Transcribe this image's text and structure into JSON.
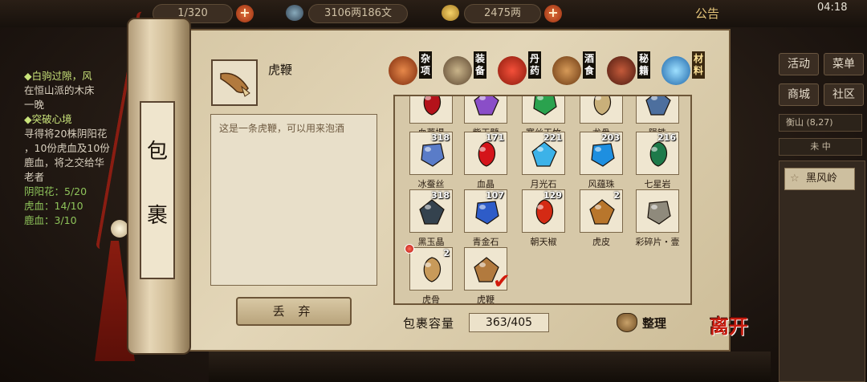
{
  "topbar": {
    "stamina": "1/320",
    "money_text": "3106两186文",
    "gold_text": "2475两",
    "notice_label": "公告",
    "clock": "04:18"
  },
  "quest": {
    "line1": "◆白驹过隙，风",
    "line2": "在恒山派的木床",
    "line3": "一晚",
    "line4": "◆突破心境",
    "line5": "寻得将20株阴阳花",
    "line6": "，10份虎血及10份",
    "line7": "鹿血，将之交给华",
    "line8": "老者",
    "req1": "阴阳花：5/20",
    "req2": "虎血：14/10",
    "req3": "鹿血：3/10"
  },
  "right_panel": {
    "btn_activity": "活动",
    "btn_menu": "菜单",
    "btn_shop": "商城",
    "btn_community": "社区",
    "location": "衡山",
    "coords": "(8,27)",
    "time_slot": "未 中",
    "place": "黑风岭"
  },
  "scroll": {
    "title_char1": "包",
    "title_char2": "裹"
  },
  "selected": {
    "name": "虎鞭",
    "description": "这是一条虎鞭，可以用来泡酒",
    "discard_label": "丢 弃"
  },
  "tabs": [
    {
      "label": "杂项",
      "icon": "misc-jar-icon",
      "color": "#b64e1c"
    },
    {
      "label": "装备",
      "icon": "equipment-icon",
      "color": "#7b6a52"
    },
    {
      "label": "丹药",
      "icon": "pill-icon",
      "color": "#c43a1c"
    },
    {
      "label": "酒食",
      "icon": "wine-food-icon",
      "color": "#9c5a28"
    },
    {
      "label": "秘籍",
      "icon": "manual-book-icon",
      "color": "#7a3a2a"
    },
    {
      "label": "材料",
      "icon": "material-crystal-icon",
      "color": "#3c8fd0"
    }
  ],
  "items": [
    {
      "name": "血菩提",
      "qty": "",
      "color": "#b4121a",
      "icon": "red-fruit-icon"
    },
    {
      "name": "紫玉髓",
      "qty": "",
      "color": "#8a4ec8",
      "icon": "purple-crystal-icon"
    },
    {
      "name": "寒丝玉竹",
      "qty": "",
      "color": "#2aa24e",
      "icon": "green-bamboo-icon"
    },
    {
      "name": "龙骨",
      "qty": "",
      "color": "#c9b07a",
      "icon": "dragon-bone-icon"
    },
    {
      "name": "陨铁",
      "qty": "",
      "color": "#4d6f9e",
      "icon": "meteor-iron-icon"
    },
    {
      "name": "冰蚕丝",
      "qty": "318",
      "color": "#5a7cc8",
      "icon": "silk-cocoon-icon"
    },
    {
      "name": "血晶",
      "qty": "171",
      "color": "#d4141a",
      "icon": "blood-crystal-icon"
    },
    {
      "name": "月光石",
      "qty": "221",
      "color": "#3cb2e8",
      "icon": "moonstone-icon"
    },
    {
      "name": "风蕴珠",
      "qty": "203",
      "color": "#1e8fe0",
      "icon": "wind-pearl-icon"
    },
    {
      "name": "七星岩",
      "qty": "216",
      "color": "#1e7a4a",
      "icon": "seven-star-rock-icon"
    },
    {
      "name": "黑玉晶",
      "qty": "318",
      "color": "#34424e",
      "icon": "black-jade-icon"
    },
    {
      "name": "青金石",
      "qty": "107",
      "color": "#2e5cc8",
      "icon": "lapis-icon"
    },
    {
      "name": "朝天椒",
      "qty": "129",
      "color": "#d42a14",
      "icon": "chili-icon"
    },
    {
      "name": "虎皮",
      "qty": "2",
      "color": "#b8762c",
      "icon": "tiger-pelt-icon"
    },
    {
      "name": "彩碎片・壹",
      "qty": "",
      "color": "#8f8a7c",
      "icon": "shard-icon"
    },
    {
      "name": "虎骨",
      "qty": "2",
      "color": "#c89a5a",
      "icon": "tiger-bone-icon"
    },
    {
      "name": "虎鞭",
      "qty": "",
      "color": "#b27a3e",
      "icon": "tiger-whip-icon"
    }
  ],
  "capacity": {
    "label": "包裹容量",
    "value": "363/405"
  },
  "sort_label": "整理",
  "leave_label": "离开"
}
